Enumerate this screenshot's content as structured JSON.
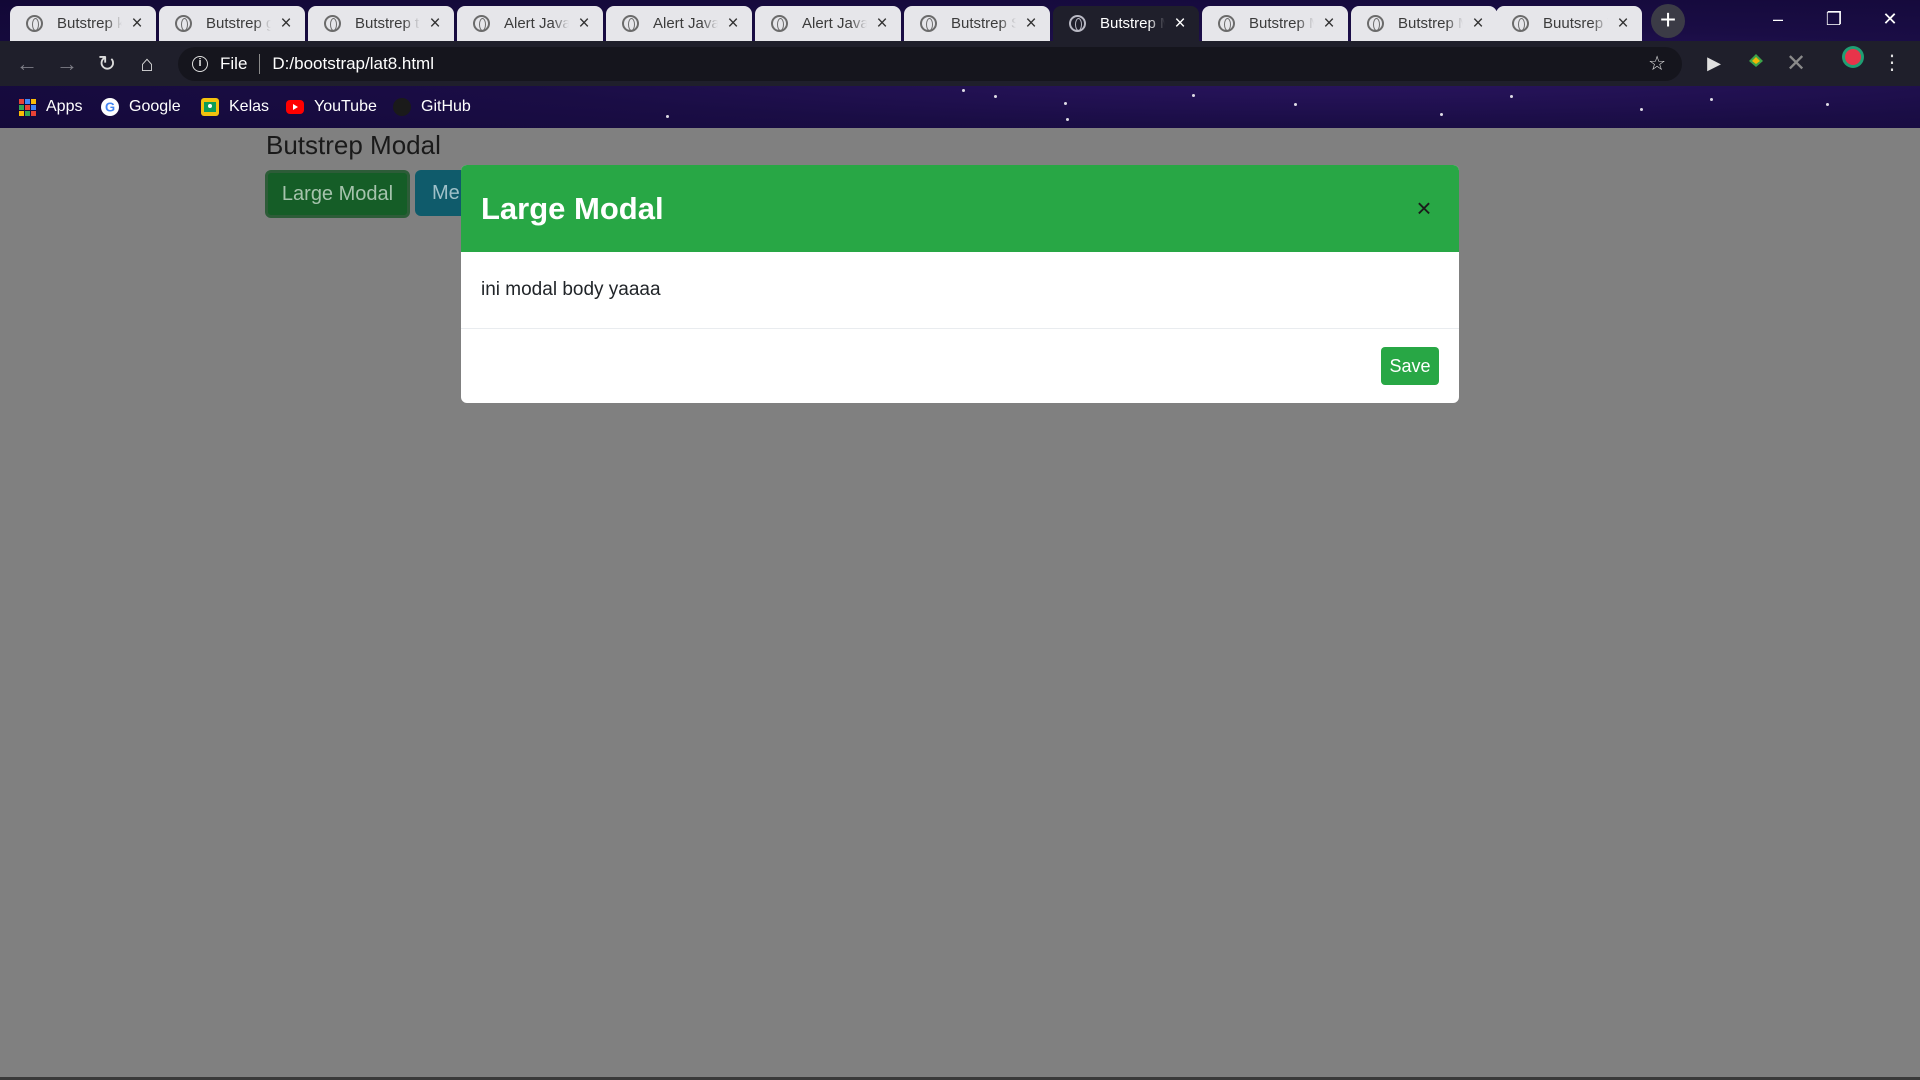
{
  "browser": {
    "tabs": [
      {
        "title": "Butstrep k",
        "active": false
      },
      {
        "title": "Butstrep g",
        "active": false
      },
      {
        "title": "Butstrep t",
        "active": false
      },
      {
        "title": "Alert Java",
        "active": false
      },
      {
        "title": "Alert Java",
        "active": false
      },
      {
        "title": "Alert Java",
        "active": false
      },
      {
        "title": "Butstrep S",
        "active": false
      },
      {
        "title": "Butstrep M",
        "active": true
      },
      {
        "title": "Butstrep M",
        "active": false
      },
      {
        "title": "Butstrep M",
        "active": false
      },
      {
        "title": "Buutsrep T",
        "active": false
      }
    ],
    "new_tab_symbol": "+",
    "address_bar": {
      "scheme_label": "File",
      "url": "D:/bootstrap/lat8.html"
    },
    "bookmarks": [
      {
        "label": "Apps",
        "icon": "apps-grid-icon"
      },
      {
        "label": "Google",
        "icon": "google-icon"
      },
      {
        "label": "Kelas",
        "icon": "classroom-icon"
      },
      {
        "label": "YouTube",
        "icon": "youtube-icon"
      },
      {
        "label": "GitHub",
        "icon": "github-icon"
      }
    ],
    "window_controls": {
      "minimize": "–",
      "restore": "❐",
      "close": "✕"
    }
  },
  "page": {
    "heading": "Butstrep Modal",
    "buttons": {
      "large_modal": "Large Modal",
      "medium_modal_partial": "Me"
    }
  },
  "modal": {
    "title": "Large Modal",
    "close_symbol": "×",
    "body": "ini modal body yaaaa",
    "save_label": "Save"
  },
  "colors": {
    "success_green": "#28a745",
    "backdrop": "#808080",
    "active_tab": "#1f1f2b"
  }
}
